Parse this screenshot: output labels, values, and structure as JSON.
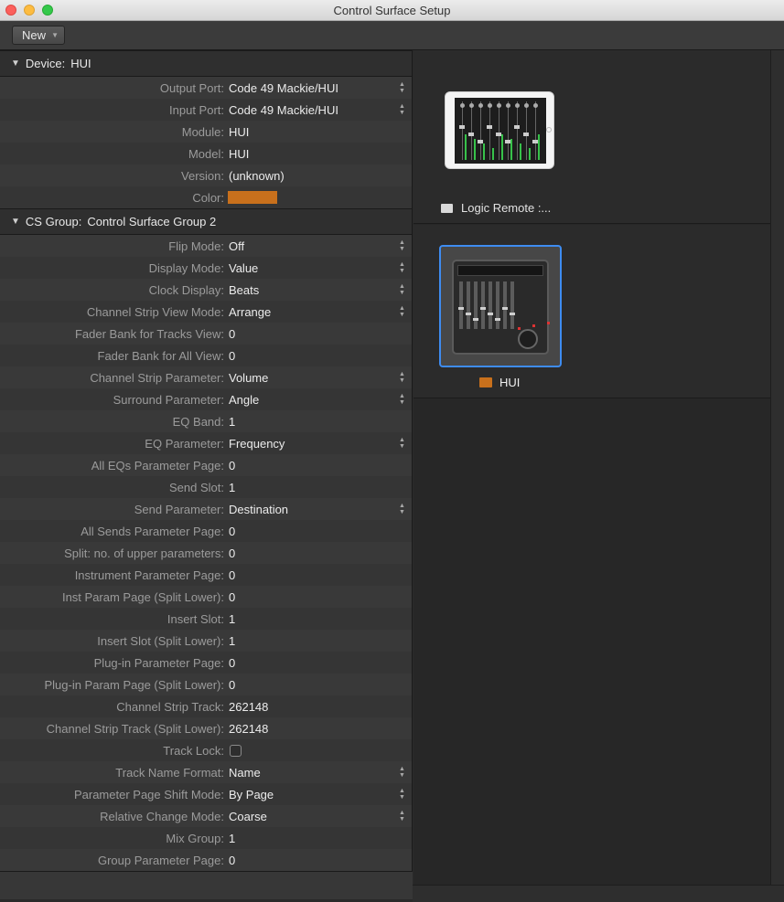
{
  "window": {
    "title": "Control Surface Setup"
  },
  "toolbar": {
    "new_label": "New"
  },
  "device_section": {
    "heading": "Device:",
    "name": "HUI",
    "rows": [
      {
        "label": "Output Port:",
        "value": "Code 49 Mackie/HUI",
        "stepper": true
      },
      {
        "label": "Input Port:",
        "value": "Code 49 Mackie/HUI",
        "stepper": true
      },
      {
        "label": "Module:",
        "value": "HUI",
        "stepper": false
      },
      {
        "label": "Model:",
        "value": "HUI",
        "stepper": false
      },
      {
        "label": "Version:",
        "value": "(unknown)",
        "stepper": false
      },
      {
        "label": "Color:",
        "value": "",
        "color": "#c8701c",
        "stepper": false
      }
    ]
  },
  "group_section": {
    "heading": "CS Group:",
    "name": "Control Surface Group 2",
    "rows": [
      {
        "label": "Flip Mode:",
        "value": "Off",
        "stepper": true
      },
      {
        "label": "Display Mode:",
        "value": "Value",
        "stepper": true
      },
      {
        "label": "Clock Display:",
        "value": "Beats",
        "stepper": true
      },
      {
        "label": "Channel Strip View Mode:",
        "value": "Arrange",
        "stepper": true
      },
      {
        "label": "Fader Bank for Tracks View:",
        "value": "0",
        "stepper": false
      },
      {
        "label": "Fader Bank for All View:",
        "value": "0",
        "stepper": false
      },
      {
        "label": "Channel Strip Parameter:",
        "value": "Volume",
        "stepper": true
      },
      {
        "label": "Surround Parameter:",
        "value": "Angle",
        "stepper": true
      },
      {
        "label": "EQ Band:",
        "value": "1",
        "stepper": false
      },
      {
        "label": "EQ Parameter:",
        "value": "Frequency",
        "stepper": true
      },
      {
        "label": "All EQs Parameter Page:",
        "value": "0",
        "stepper": false
      },
      {
        "label": "Send Slot:",
        "value": "1",
        "stepper": false
      },
      {
        "label": "Send Parameter:",
        "value": "Destination",
        "stepper": true
      },
      {
        "label": "All Sends Parameter Page:",
        "value": "0",
        "stepper": false
      },
      {
        "label": "Split: no. of upper parameters:",
        "value": "0",
        "stepper": false
      },
      {
        "label": "Instrument Parameter Page:",
        "value": "0",
        "stepper": false
      },
      {
        "label": "Inst Param Page (Split Lower):",
        "value": "0",
        "stepper": false
      },
      {
        "label": "Insert Slot:",
        "value": "1",
        "stepper": false
      },
      {
        "label": "Insert Slot (Split Lower):",
        "value": "1",
        "stepper": false
      },
      {
        "label": "Plug-in Parameter Page:",
        "value": "0",
        "stepper": false
      },
      {
        "label": "Plug-in Param Page (Split Lower):",
        "value": "0",
        "stepper": false
      },
      {
        "label": "Channel Strip Track:",
        "value": "262148",
        "stepper": false
      },
      {
        "label": "Channel Strip Track (Split Lower):",
        "value": "262148",
        "stepper": false
      },
      {
        "label": "Track Lock:",
        "value": "",
        "checkbox": true,
        "checked": false,
        "stepper": false
      },
      {
        "label": "Track Name Format:",
        "value": "Name",
        "stepper": true
      },
      {
        "label": "Parameter Page Shift Mode:",
        "value": "By Page",
        "stepper": true
      },
      {
        "label": "Relative Change Mode:",
        "value": "Coarse",
        "stepper": true
      },
      {
        "label": "Mix Group:",
        "value": "1",
        "stepper": false
      },
      {
        "label": "Group Parameter Page:",
        "value": "0",
        "stepper": false
      }
    ]
  },
  "devices": [
    {
      "label": "Logic Remote :...",
      "color": "#d9d9d9",
      "icon": "ipad-icon",
      "selected": false
    },
    {
      "label": "HUI",
      "color": "#c8701c",
      "icon": "hui-controller-icon",
      "selected": true
    }
  ],
  "colors": {
    "accent": "#3e8cf1",
    "device_color": "#c8701c"
  }
}
